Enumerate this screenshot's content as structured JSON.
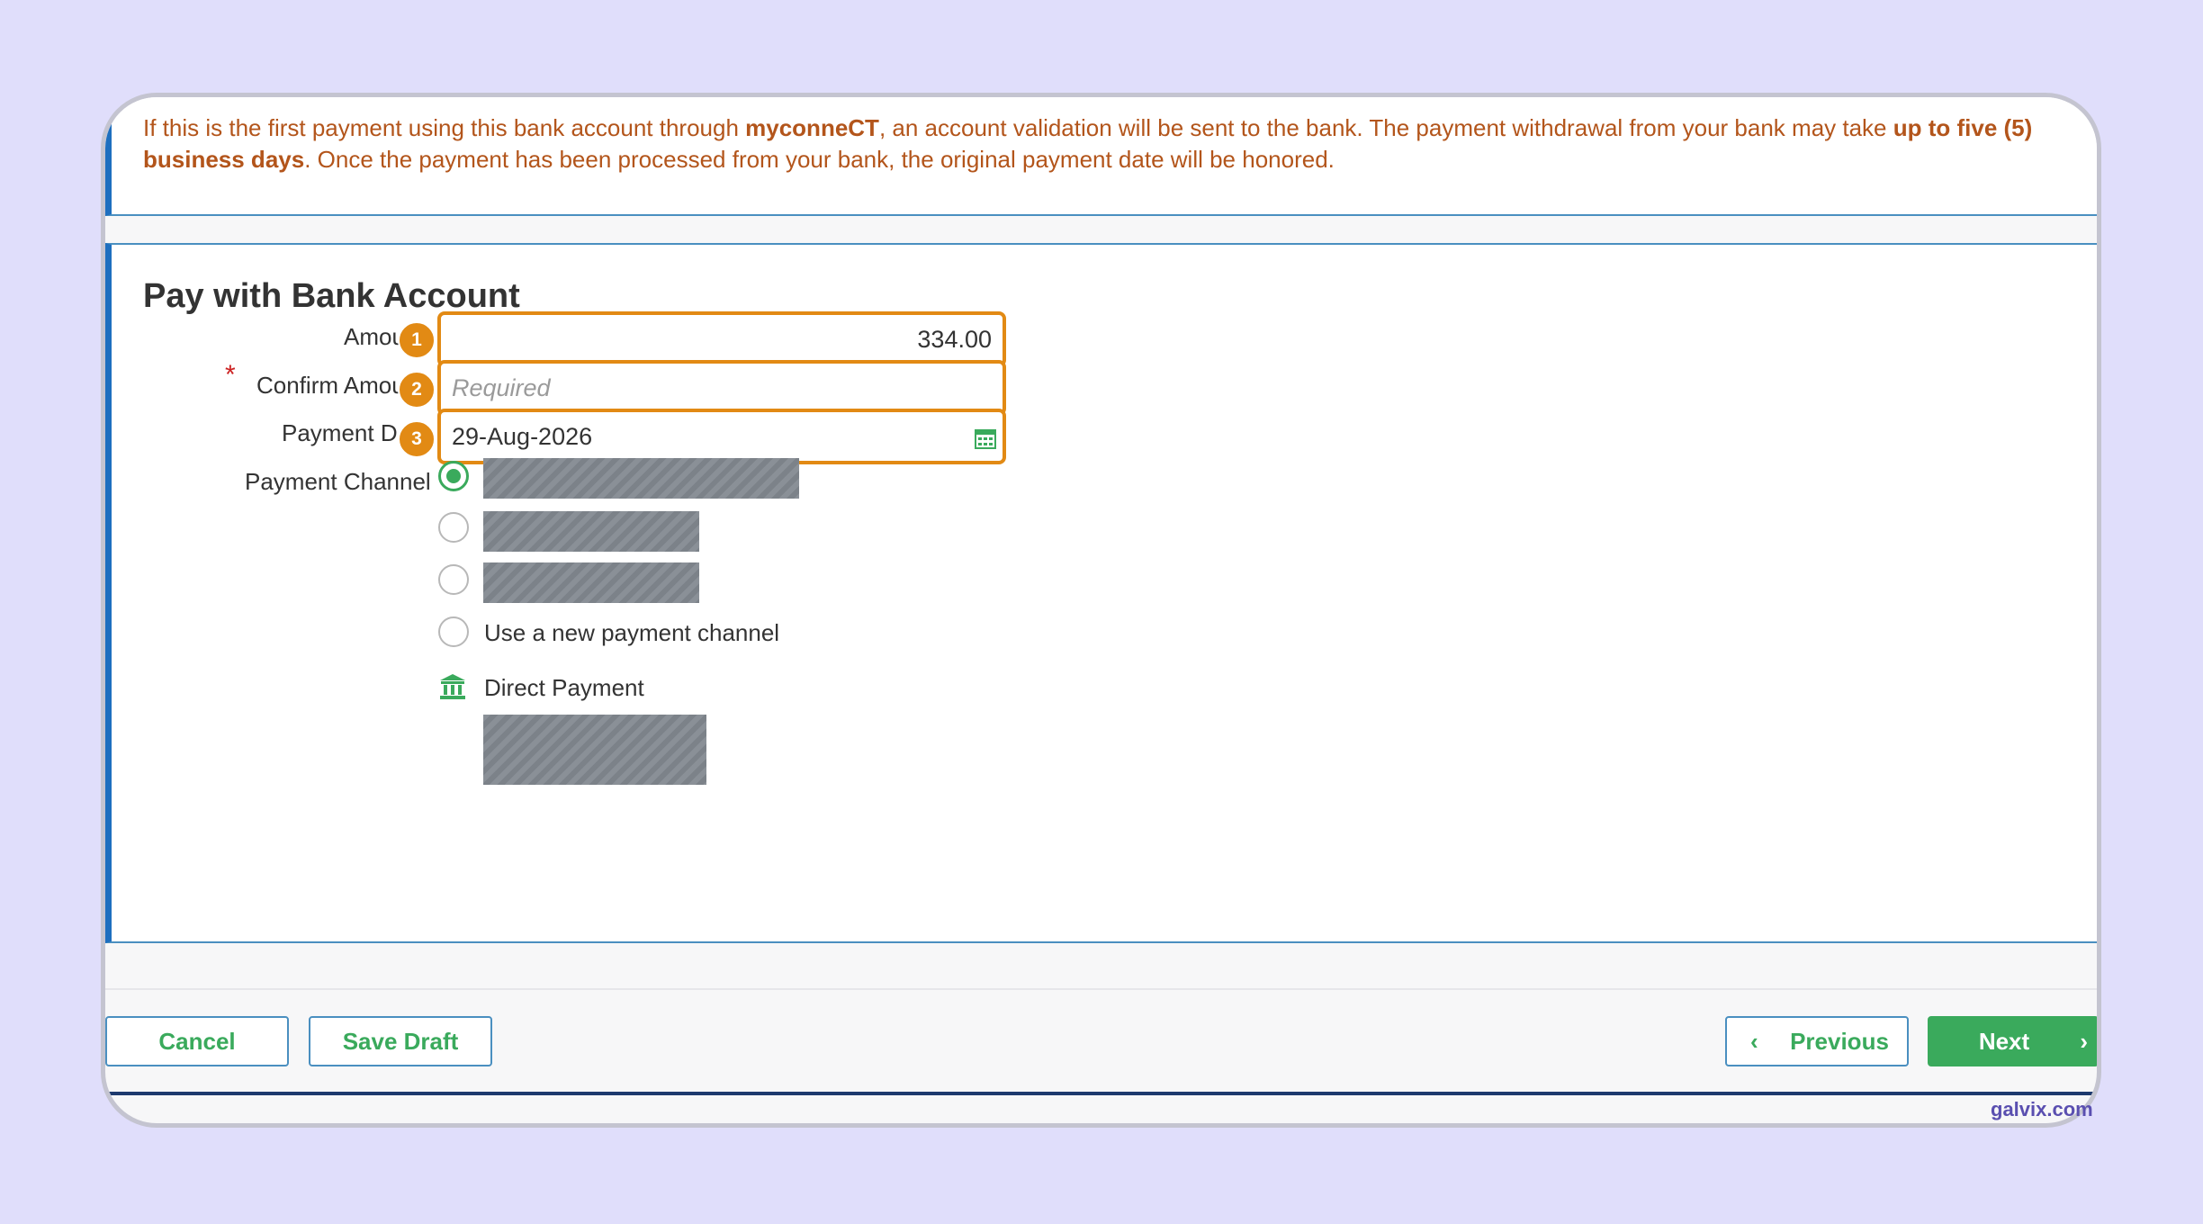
{
  "notice": {
    "part1": "If this is the first payment using this bank account through ",
    "brand": "myconneCT",
    "part2": ", an account validation will be sent to the bank. The payment withdrawal from your bank may take ",
    "bold_days": "up to five (5) business days",
    "part3": ". Once the payment has been processed from your bank, the original payment date will be honored."
  },
  "form": {
    "title": "Pay with Bank Account",
    "amount_label": "Amou",
    "amount_value": "334.00",
    "confirm_label": "Confirm Amou",
    "confirm_placeholder": "Required",
    "date_label": "Payment D",
    "date_value": "29-Aug-2026",
    "channel_label": "Payment Channel",
    "new_channel_label": "Use a new payment channel",
    "direct_payment_label": "Direct Payment",
    "required_mark": "*"
  },
  "badges": [
    "1",
    "2",
    "3"
  ],
  "footer": {
    "cancel": "Cancel",
    "save_draft": "Save Draft",
    "previous": "Previous",
    "next": "Next",
    "prev_chevron": "‹",
    "next_chevron": "›"
  },
  "watermark": "galvix.com",
  "colors": {
    "accent_orange": "#e28a14",
    "notice_text": "#b3551b",
    "primary_green": "#3aaa5c",
    "panel_border_blue": "#1e6fbf"
  },
  "icons": {
    "date_picker": "calendar-icon",
    "direct_payment": "bank-icon"
  }
}
